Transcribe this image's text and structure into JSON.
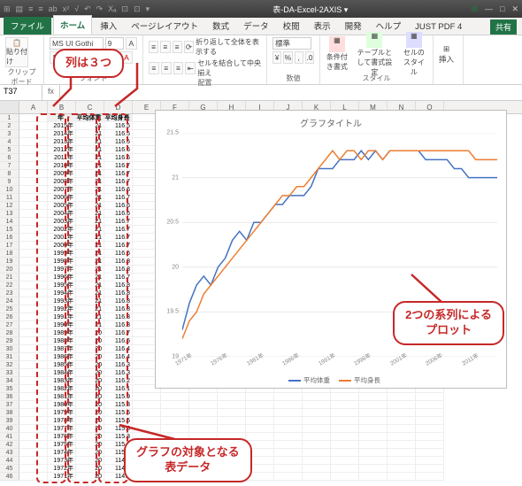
{
  "title": "表-DA-Excel-2AXIS",
  "tabs": {
    "file": "ファイル",
    "home": "ホーム",
    "insert": "挿入",
    "pagelayout": "ページレイアウト",
    "formulas": "数式",
    "data": "データ",
    "review": "校閲",
    "view": "表示",
    "dev": "開発",
    "help": "ヘルプ",
    "justpdf": "JUST PDF 4"
  },
  "share": "共有",
  "ribbon": {
    "clipboard": "クリップボード",
    "paste": "貼り付け",
    "font": "フォント",
    "fontname": "MS UI Gothi",
    "fontsize": "9",
    "align": "配置",
    "wrap": "折り返して全体を表示する",
    "merge": "セルを結合して中央揃え",
    "number": "数値",
    "numfmt": "標準",
    "styles": "スタイル",
    "condfmt": "条件付き書式",
    "tblfmt": "テーブルとして書式設定",
    "cellsty": "セルのスタイル",
    "insertg": "挿入"
  },
  "namebox": "T37",
  "columns": [
    "A",
    "B",
    "C",
    "D",
    "E",
    "F",
    "G",
    "H",
    "I",
    "J",
    "K",
    "L",
    "M",
    "N",
    "O"
  ],
  "hdr": {
    "year": "年",
    "weight": "平均体重",
    "height": "平均身長"
  },
  "table": [
    [
      "2015年",
      21,
      116.5
    ],
    [
      "2014年",
      21,
      116.5
    ],
    [
      "2013年",
      21,
      116.5
    ],
    [
      "2012年",
      21,
      116.6
    ],
    [
      "2011年",
      21,
      116.6
    ],
    [
      "2010年",
      21,
      116.7
    ],
    [
      "2009年",
      21,
      116.7
    ],
    [
      "2008年",
      21,
      116.7
    ],
    [
      "2007年",
      21,
      116.6
    ],
    [
      "2006年",
      21,
      116.7
    ],
    [
      "2005年",
      21,
      116.6
    ],
    [
      "2004年",
      21,
      116.6
    ],
    [
      "2003年",
      21,
      116.7
    ],
    [
      "2002年",
      21,
      116.7
    ],
    [
      "2001年",
      21,
      116.7
    ],
    [
      "2000年",
      21,
      116.7
    ],
    [
      "1999年",
      21,
      116.6
    ],
    [
      "1998年",
      21,
      116.8
    ],
    [
      "1997年",
      21,
      116.8
    ],
    [
      "1996年",
      21,
      116.7
    ],
    [
      "1995年",
      21,
      116.8
    ],
    [
      "1994年",
      21,
      116.8
    ],
    [
      "1993年",
      21,
      116.8
    ],
    [
      "1992年",
      21,
      116.8
    ],
    [
      "1991年",
      21,
      116.8
    ],
    [
      "1990年",
      21,
      116.8
    ],
    [
      "1989年",
      20,
      116.7
    ],
    [
      "1988年",
      20,
      116.5
    ],
    [
      "1987年",
      20,
      116.4
    ],
    [
      "1986年",
      20,
      116.4
    ],
    [
      "1985年",
      20,
      116.3
    ],
    [
      "1984年",
      20,
      116.3
    ],
    [
      "1983年",
      20,
      116.2
    ],
    [
      "1982年",
      20,
      116.1
    ],
    [
      "1981年",
      20,
      115.9
    ],
    [
      "1980年",
      20,
      115.8
    ],
    [
      "1979年",
      20,
      115.5
    ],
    [
      "1978年",
      20,
      115.5
    ],
    [
      "1977年",
      20,
      115.5
    ],
    [
      "1976年",
      20,
      115.3
    ],
    [
      "1975年",
      20,
      115.1
    ],
    [
      "1974年",
      20,
      115.1
    ],
    [
      "1973年",
      20,
      114.9
    ],
    [
      "1972年",
      20,
      114.8
    ],
    [
      "1971年",
      20,
      114.5
    ]
  ],
  "chart_data": {
    "type": "line",
    "title": "グラフタイトル",
    "x_ticks": [
      "1971年",
      "1976年",
      "1981年",
      "1986年",
      "1991年",
      "1996年",
      "2001年",
      "2006年",
      "2011年"
    ],
    "y_ticks": [
      19,
      19.5,
      20,
      20.5,
      21,
      21.5
    ],
    "series": [
      {
        "name": "平均体重",
        "color": "#4472c4",
        "x": [
          1971,
          1972,
          1973,
          1974,
          1975,
          1976,
          1977,
          1978,
          1979,
          1980,
          1981,
          1982,
          1983,
          1984,
          1985,
          1986,
          1987,
          1988,
          1989,
          1990,
          1991,
          1992,
          1993,
          1994,
          1995,
          1996,
          1997,
          1998,
          1999,
          2000,
          2001,
          2002,
          2003,
          2004,
          2005,
          2006,
          2007,
          2008,
          2009,
          2010,
          2011,
          2012,
          2013,
          2014,
          2015
        ],
        "values": [
          19.3,
          19.6,
          19.8,
          19.9,
          19.8,
          20.0,
          20.1,
          20.3,
          20.4,
          20.3,
          20.5,
          20.5,
          20.6,
          20.7,
          20.7,
          20.8,
          20.8,
          20.8,
          20.9,
          21.1,
          21.1,
          21.1,
          21.2,
          21.2,
          21.2,
          21.3,
          21.2,
          21.3,
          21.2,
          21.3,
          21.3,
          21.3,
          21.3,
          21.3,
          21.2,
          21.2,
          21.2,
          21.2,
          21.1,
          21.1,
          21.0,
          21.0,
          21.0,
          21.0,
          21.0
        ]
      },
      {
        "name": "平均身長",
        "color": "#ed7d31",
        "x": [
          1971,
          1972,
          1973,
          1974,
          1975,
          1976,
          1977,
          1978,
          1979,
          1980,
          1981,
          1982,
          1983,
          1984,
          1985,
          1986,
          1987,
          1988,
          1989,
          1990,
          1991,
          1992,
          1993,
          1994,
          1995,
          1996,
          1997,
          1998,
          1999,
          2000,
          2001,
          2002,
          2003,
          2004,
          2005,
          2006,
          2007,
          2008,
          2009,
          2010,
          2011,
          2012,
          2013,
          2014,
          2015
        ],
        "values": [
          19.2,
          19.4,
          19.5,
          19.7,
          19.8,
          19.9,
          20.0,
          20.1,
          20.2,
          20.3,
          20.4,
          20.5,
          20.6,
          20.7,
          20.8,
          20.8,
          20.9,
          20.9,
          21.0,
          21.1,
          21.2,
          21.3,
          21.2,
          21.3,
          21.3,
          21.2,
          21.3,
          21.3,
          21.2,
          21.3,
          21.3,
          21.3,
          21.3,
          21.3,
          21.3,
          21.3,
          21.3,
          21.3,
          21.3,
          21.3,
          21.3,
          21.2,
          21.2,
          21.2,
          21.2
        ]
      }
    ],
    "ylim": [
      19,
      21.5
    ],
    "xlim": [
      1971,
      2015
    ]
  },
  "annot": {
    "cols3": "列は３つ",
    "twoseries": "2つの系列による\nプロット",
    "tabledata": "グラフの対象となる\n表データ"
  }
}
